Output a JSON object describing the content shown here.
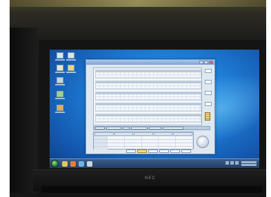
{
  "photo": {
    "brand_label": "NEC"
  },
  "desktop": {
    "icons": [
      {
        "name": "computer-icon"
      },
      {
        "name": "network-icon"
      },
      {
        "name": "document-icon"
      },
      {
        "name": "folder-icon"
      },
      {
        "name": "recycle-bin-icon"
      },
      {
        "name": "application-icon"
      },
      {
        "name": "shortcut-icon"
      }
    ]
  },
  "app_window": {
    "title": "",
    "grid_bands": 5,
    "side_buttons": 6,
    "status_items": 8,
    "bottom_buttons": 6,
    "highlighted_button_index": 1
  },
  "taskbar": {
    "start_icon": "windows-start-icon",
    "pinned_icons": [
      "explorer-icon",
      "media-icon",
      "browser-icon",
      "app-icon"
    ],
    "tray_icons": [
      "flag-icon",
      "network-icon",
      "volume-icon"
    ]
  },
  "colors": {
    "desktop": "#1f7fd6",
    "taskbar": "#213c63",
    "window": "#dfe7ef",
    "highlight": "#f6df7a"
  }
}
